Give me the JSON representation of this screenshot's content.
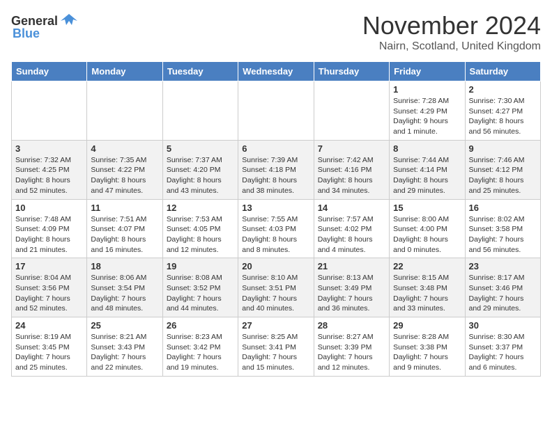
{
  "header": {
    "logo_general": "General",
    "logo_blue": "Blue",
    "month_title": "November 2024",
    "subtitle": "Nairn, Scotland, United Kingdom"
  },
  "days_of_week": [
    "Sunday",
    "Monday",
    "Tuesday",
    "Wednesday",
    "Thursday",
    "Friday",
    "Saturday"
  ],
  "weeks": [
    [
      {
        "day": "",
        "info": ""
      },
      {
        "day": "",
        "info": ""
      },
      {
        "day": "",
        "info": ""
      },
      {
        "day": "",
        "info": ""
      },
      {
        "day": "",
        "info": ""
      },
      {
        "day": "1",
        "info": "Sunrise: 7:28 AM\nSunset: 4:29 PM\nDaylight: 9 hours and 1 minute."
      },
      {
        "day": "2",
        "info": "Sunrise: 7:30 AM\nSunset: 4:27 PM\nDaylight: 8 hours and 56 minutes."
      }
    ],
    [
      {
        "day": "3",
        "info": "Sunrise: 7:32 AM\nSunset: 4:25 PM\nDaylight: 8 hours and 52 minutes."
      },
      {
        "day": "4",
        "info": "Sunrise: 7:35 AM\nSunset: 4:22 PM\nDaylight: 8 hours and 47 minutes."
      },
      {
        "day": "5",
        "info": "Sunrise: 7:37 AM\nSunset: 4:20 PM\nDaylight: 8 hours and 43 minutes."
      },
      {
        "day": "6",
        "info": "Sunrise: 7:39 AM\nSunset: 4:18 PM\nDaylight: 8 hours and 38 minutes."
      },
      {
        "day": "7",
        "info": "Sunrise: 7:42 AM\nSunset: 4:16 PM\nDaylight: 8 hours and 34 minutes."
      },
      {
        "day": "8",
        "info": "Sunrise: 7:44 AM\nSunset: 4:14 PM\nDaylight: 8 hours and 29 minutes."
      },
      {
        "day": "9",
        "info": "Sunrise: 7:46 AM\nSunset: 4:12 PM\nDaylight: 8 hours and 25 minutes."
      }
    ],
    [
      {
        "day": "10",
        "info": "Sunrise: 7:48 AM\nSunset: 4:09 PM\nDaylight: 8 hours and 21 minutes."
      },
      {
        "day": "11",
        "info": "Sunrise: 7:51 AM\nSunset: 4:07 PM\nDaylight: 8 hours and 16 minutes."
      },
      {
        "day": "12",
        "info": "Sunrise: 7:53 AM\nSunset: 4:05 PM\nDaylight: 8 hours and 12 minutes."
      },
      {
        "day": "13",
        "info": "Sunrise: 7:55 AM\nSunset: 4:03 PM\nDaylight: 8 hours and 8 minutes."
      },
      {
        "day": "14",
        "info": "Sunrise: 7:57 AM\nSunset: 4:02 PM\nDaylight: 8 hours and 4 minutes."
      },
      {
        "day": "15",
        "info": "Sunrise: 8:00 AM\nSunset: 4:00 PM\nDaylight: 8 hours and 0 minutes."
      },
      {
        "day": "16",
        "info": "Sunrise: 8:02 AM\nSunset: 3:58 PM\nDaylight: 7 hours and 56 minutes."
      }
    ],
    [
      {
        "day": "17",
        "info": "Sunrise: 8:04 AM\nSunset: 3:56 PM\nDaylight: 7 hours and 52 minutes."
      },
      {
        "day": "18",
        "info": "Sunrise: 8:06 AM\nSunset: 3:54 PM\nDaylight: 7 hours and 48 minutes."
      },
      {
        "day": "19",
        "info": "Sunrise: 8:08 AM\nSunset: 3:52 PM\nDaylight: 7 hours and 44 minutes."
      },
      {
        "day": "20",
        "info": "Sunrise: 8:10 AM\nSunset: 3:51 PM\nDaylight: 7 hours and 40 minutes."
      },
      {
        "day": "21",
        "info": "Sunrise: 8:13 AM\nSunset: 3:49 PM\nDaylight: 7 hours and 36 minutes."
      },
      {
        "day": "22",
        "info": "Sunrise: 8:15 AM\nSunset: 3:48 PM\nDaylight: 7 hours and 33 minutes."
      },
      {
        "day": "23",
        "info": "Sunrise: 8:17 AM\nSunset: 3:46 PM\nDaylight: 7 hours and 29 minutes."
      }
    ],
    [
      {
        "day": "24",
        "info": "Sunrise: 8:19 AM\nSunset: 3:45 PM\nDaylight: 7 hours and 25 minutes."
      },
      {
        "day": "25",
        "info": "Sunrise: 8:21 AM\nSunset: 3:43 PM\nDaylight: 7 hours and 22 minutes."
      },
      {
        "day": "26",
        "info": "Sunrise: 8:23 AM\nSunset: 3:42 PM\nDaylight: 7 hours and 19 minutes."
      },
      {
        "day": "27",
        "info": "Sunrise: 8:25 AM\nSunset: 3:41 PM\nDaylight: 7 hours and 15 minutes."
      },
      {
        "day": "28",
        "info": "Sunrise: 8:27 AM\nSunset: 3:39 PM\nDaylight: 7 hours and 12 minutes."
      },
      {
        "day": "29",
        "info": "Sunrise: 8:28 AM\nSunset: 3:38 PM\nDaylight: 7 hours and 9 minutes."
      },
      {
        "day": "30",
        "info": "Sunrise: 8:30 AM\nSunset: 3:37 PM\nDaylight: 7 hours and 6 minutes."
      }
    ]
  ]
}
